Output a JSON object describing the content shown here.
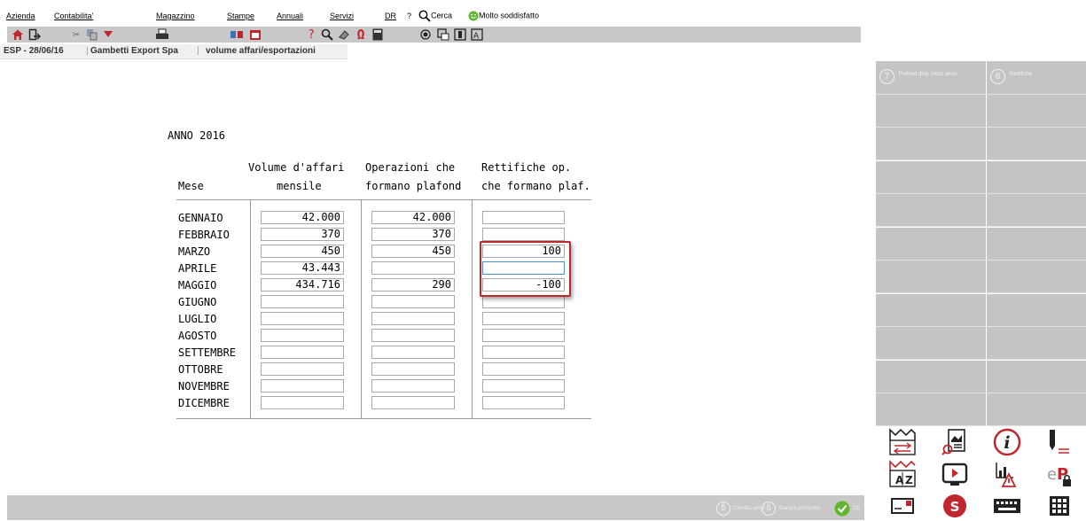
{
  "menu": {
    "items": [
      "Azienda",
      "Contabilita'",
      "Magazzino",
      "Stampe",
      "Annuali",
      "Servizi",
      "DR",
      "?"
    ],
    "search_label": "Cerca",
    "satisfaction_label": "Molto soddisfatto"
  },
  "breadcrumb": {
    "session": "ESP - 28/06/16",
    "company": "Gambetti Export Spa",
    "page": "volume affari/esportazioni"
  },
  "form": {
    "year_label": "ANNO 2016",
    "col_month": "Mese",
    "col_volume_l1": "Volume d'affari",
    "col_volume_l2": "mensile",
    "col_ops_l1": "Operazioni che",
    "col_ops_l2": "formano plafond",
    "col_rett_l1": "Rettifiche op.",
    "col_rett_l2": "che formano plaf.",
    "rows": [
      {
        "month": "GENNAIO",
        "volume": "42.000",
        "ops": "42.000",
        "rett": ""
      },
      {
        "month": "FEBBRAIO",
        "volume": "370",
        "ops": "370",
        "rett": ""
      },
      {
        "month": "MARZO",
        "volume": "450",
        "ops": "450",
        "rett": "100"
      },
      {
        "month": "APRILE",
        "volume": "43.443",
        "ops": "",
        "rett": ""
      },
      {
        "month": "MAGGIO",
        "volume": "434.716",
        "ops": "290",
        "rett": "-100"
      },
      {
        "month": "GIUGNO",
        "volume": "",
        "ops": "",
        "rett": ""
      },
      {
        "month": "LUGLIO",
        "volume": "",
        "ops": "",
        "rett": ""
      },
      {
        "month": "AGOSTO",
        "volume": "",
        "ops": "",
        "rett": ""
      },
      {
        "month": "SETTEMBRE",
        "volume": "",
        "ops": "",
        "rett": ""
      },
      {
        "month": "OTTOBRE",
        "volume": "",
        "ops": "",
        "rett": ""
      },
      {
        "month": "NOVEMBRE",
        "volume": "",
        "ops": "",
        "rett": ""
      },
      {
        "month": "DICEMBRE",
        "volume": "",
        "ops": "",
        "rett": ""
      }
    ]
  },
  "side_panel": {
    "btn7_num": "7",
    "btn7_label": "Plafond disp. inizio anno",
    "btn8_num": "8",
    "btn8_label": "Rettifiche"
  },
  "status_bar": {
    "btn5_num": "5",
    "btn5_label": "Cambia anno",
    "btn6_num": "6",
    "btn6_label": "Stampa prospetto",
    "ok_label": "Ok"
  },
  "colors": {
    "toolbar_bg": "#c8c8c8",
    "panel_bg": "#c4c4c4",
    "highlight_red": "#c0262c",
    "focus_blue": "#4a90d9"
  }
}
